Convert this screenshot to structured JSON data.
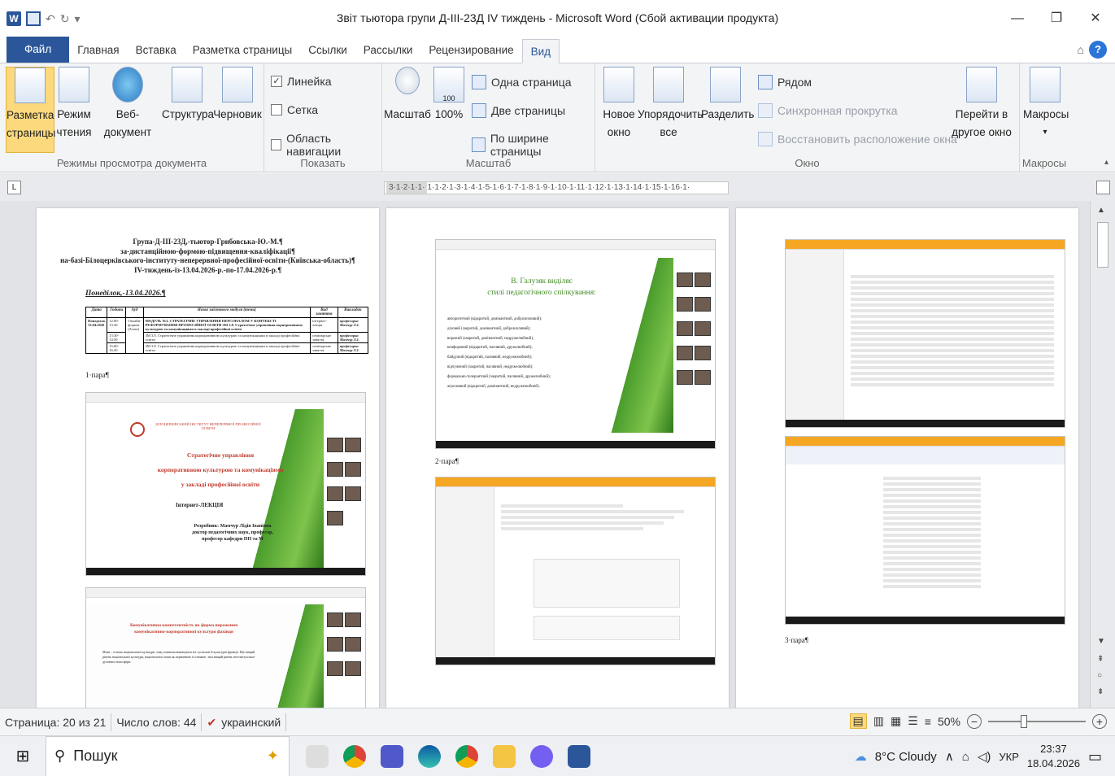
{
  "window": {
    "title": "Звіт тьютора групи Д-ІІІ-23Д  IV тиждень  -  Microsoft Word (Сбой активации продукта)"
  },
  "tabs": [
    "Файл",
    "Главная",
    "Вставка",
    "Разметка страницы",
    "Ссылки",
    "Рассылки",
    "Рецензирование",
    "Вид"
  ],
  "ribbon": {
    "views": {
      "group_label": "Режимы просмотра документа",
      "page_layout": "Разметка страницы",
      "full_screen": "Режим чтения",
      "web": "Веб-документ",
      "outline": "Структура",
      "draft": "Черновик"
    },
    "show": {
      "group_label": "Показать",
      "ruler": "Линейка",
      "gridlines": "Сетка",
      "nav_pane": "Область навигации"
    },
    "zoom": {
      "group_label": "Масштаб",
      "zoom": "Масштаб",
      "hundred": "100%",
      "hundred_icon": "100",
      "one_page": "Одна страница",
      "two_pages": "Две страницы",
      "page_width": "По ширине страницы"
    },
    "window": {
      "group_label": "Окно",
      "new_window": "Новое окно",
      "arrange_all": "Упорядочить все",
      "split": "Разделить",
      "side_by_side": "Рядом",
      "sync_scroll": "Синхронная прокрутка",
      "reset_position": "Восстановить расположение окна",
      "switch_windows": "Перейти в другое окно"
    },
    "macros": {
      "group_label": "Макросы",
      "macros": "Макросы"
    }
  },
  "ruler": {
    "left": "3·1·2·1·1·",
    "right": "1·1·2·1·3·1·4·1·5·1·6·1·7·1·8·1·9·1·10·1·11·1·12·1·13·1·14·1·15·1·16·1·"
  },
  "document": {
    "page1": {
      "heading": [
        "Група-Д-ІІІ-23Д,-тьютор-Грибовська-Ю.-М.¶",
        "за-дистанційною-формою-підвищення-кваліфікації¶",
        "на-базі-Білоцерківського-інституту-неперервної-професійної-освіти-(Київська-область)¶",
        "IV-тиждень-із-13.04.2026-р.-по-17.04.2026-р.¶"
      ],
      "day": "Понеділок,-13.04.2026.¶",
      "table_headers": [
        "Дата",
        "Години",
        "Ауд",
        "Назва змістового модуля (теми)",
        "Вид заняття",
        "Викладач"
      ],
      "table_date": "Понеділок 13.04.2026",
      "table_auditorium": "Онлайн-формат (Zoom)",
      "table_rows": [
        {
          "time": "12:00-13:20",
          "topic": "МОДУЛЬ №3. СТРАТЕГІЧНЕ УПРАВЛІННЯ ПЕРСОНАЛОМ У КОНТЕКСТІ РЕФОРМУВАННЯ ПРОФЕСІЙНОЇ ОСВІТИ ЗМ 3.8. Стратегічне управління корпоративною культурою та комунікаціями в закладі професійної освіти",
          "type": "інтернет-лекція",
          "teacher": "професорка Мамчур Л.І."
        },
        {
          "time": "13:30-14:50",
          "topic": "ЗМ 3.8. Стратегічне управління корпоративною культурою та комунікаціями в закладі професійної освіти",
          "type": "семінарське заняття",
          "teacher": "професорка Мамчур Л.І."
        },
        {
          "time": "15:00-16:20",
          "topic": "ЗМ 3.8. Стратегічне управління корпоративною культурою та комунікаціями в закладі професійної освіти",
          "type": "семінарське заняття",
          "teacher": "професорка Мамчур Л.І."
        }
      ],
      "para1": "1·пара¶",
      "slide1": {
        "institute": "БІЛОЦЕРКІВСЬКИЙ ІНСТИТУТ НЕПЕРЕРВНОЇ ПРОФЕСІЙНОЇ ОСВІТИ",
        "title_lines": [
          "Стратегічне управління",
          "корпоративною культурою та комунікаціями",
          "у закладі професійної освіти"
        ],
        "lecture": "Інтернет-ЛЕКЦІЯ",
        "author_lines": [
          "Розробник: Мамчур Лідія Іванівна",
          "доктор педагогічних наук, професор,",
          "професор кафедри ПП та М"
        ]
      },
      "slide2": {
        "title_lines": [
          "Комунікативна компетентність як форма вираження",
          "комунікативно-корпоративної культури фахівця"
        ],
        "body": "Мова – основа національної культури, тому повинна виконувати всі суспільні й культурні функції. Що вищий рівень національної культури, національної мови як первинною її ознакою, тим вищий рівень інтелектуально-духовної атмосфери."
      }
    },
    "page2": {
      "slide_title_lines": [
        "В. Галузяк виділяє",
        "стилі педагогічного спілкування:"
      ],
      "styles": [
        "авторитетний (відкритий, домінантний, доброзичливий);",
        "діловий (закритий, домінантний, доброзичливий);",
        "ворожий (закритий, домінантний, недружелюбний);",
        "конформний (відкритий, пасивний, дружелюбний);",
        "байдужий (відкритий, пасивний, недружелюбний);",
        "відчужений (закритий, пасивний, недружелюбний);",
        "формально-толерантний (закритий, пасивний, дружелюбний);",
        "агресивний (відкритий, домінантний, недружелюбний)."
      ],
      "para2": "2·пара¶"
    },
    "page3": {
      "para3": "3·пара¶"
    }
  },
  "statusbar": {
    "page": "Страница: 20 из 21",
    "words": "Число слов: 44",
    "language": "украинский",
    "zoom": "50%"
  },
  "taskbar": {
    "search": "Пошук",
    "weather": "8°C  Cloudy",
    "lang": "УКР",
    "time": "23:37",
    "date": "18.04.2026"
  }
}
